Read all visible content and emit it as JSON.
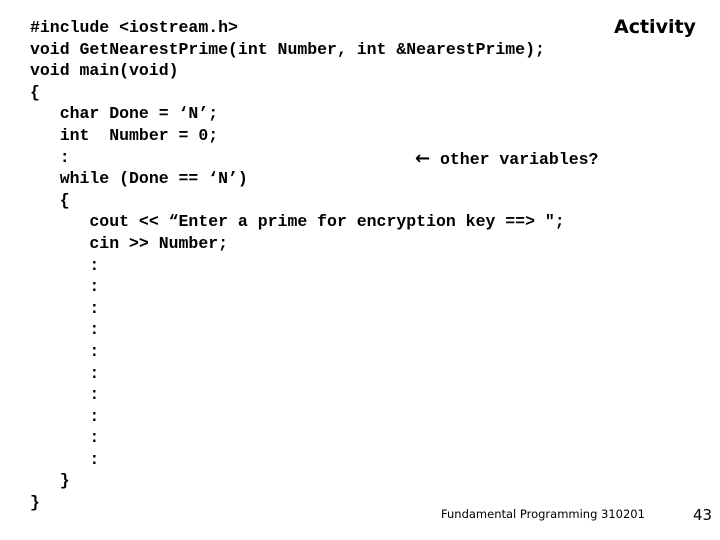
{
  "slide": {
    "title": "Activity",
    "code_lines": [
      "#include <iostream.h>",
      "void GetNearestPrime(int Number, int &NearestPrime);",
      "void main(void)",
      "{",
      "   char Done = ‘N’;",
      "   int  Number = 0;",
      "   :",
      "   while (Done == ‘N’)",
      "   {",
      "      cout << “Enter a prime for encryption key ==> \";",
      "      cin >> Number;",
      "      :",
      "      :",
      "      :",
      "      :",
      "      :",
      "      :",
      "      :",
      "      :",
      "      :",
      "      :",
      "   }",
      "}"
    ],
    "note": {
      "icon": "left-arrow-icon",
      "arrow": "←",
      "text": " other variables?"
    },
    "footer": "Fundamental Programming 310201",
    "page_number": "43"
  }
}
